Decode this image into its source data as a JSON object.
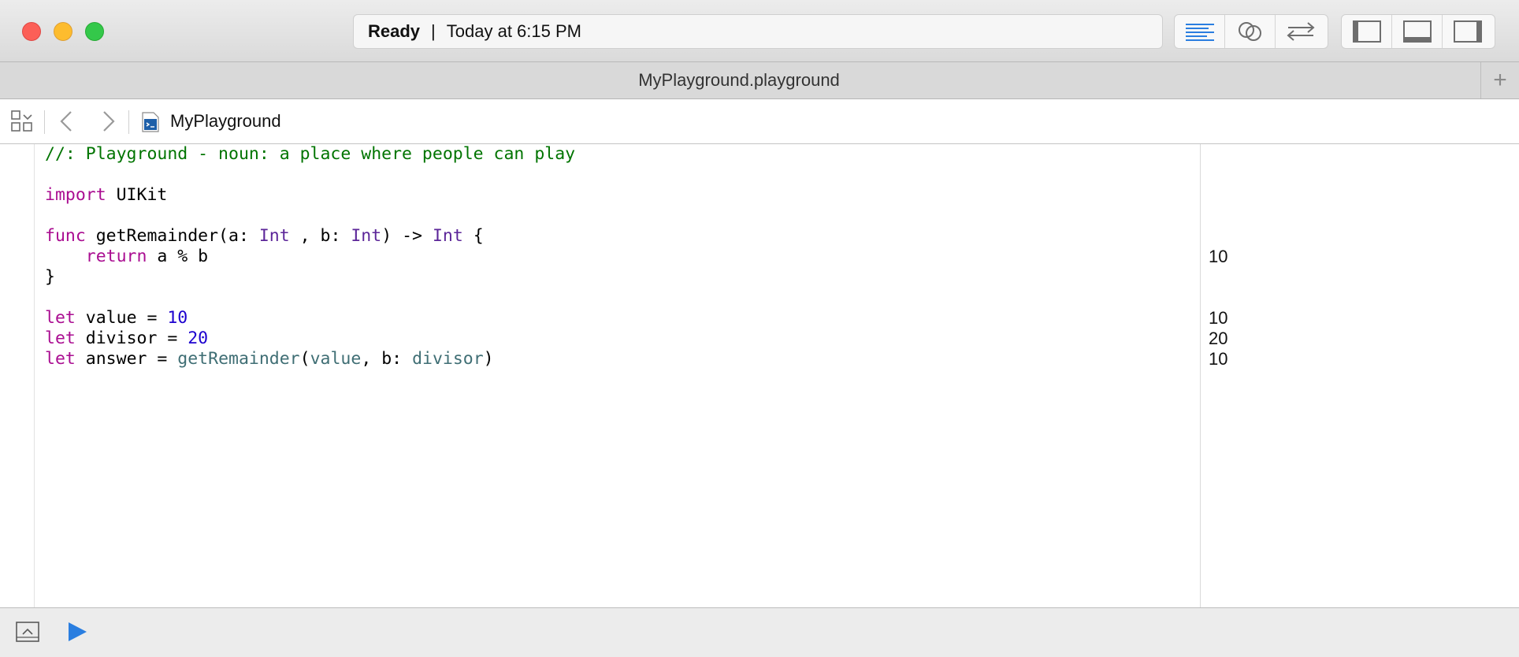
{
  "toolbar": {
    "status": "Ready",
    "separator": "|",
    "timestamp": "Today at 6:15 PM"
  },
  "tab": {
    "title": "MyPlayground.playground",
    "add_label": "+"
  },
  "jumpbar": {
    "file_label": "MyPlayground"
  },
  "editor": {
    "lines": [
      [
        {
          "t": "//: Playground - noun: a place where people can play",
          "c": "comment"
        }
      ],
      [],
      [
        {
          "t": "import",
          "c": "kw"
        },
        {
          "t": " UIKit",
          "c": ""
        }
      ],
      [],
      [
        {
          "t": "func",
          "c": "kw"
        },
        {
          "t": " getRemainder(a: ",
          "c": ""
        },
        {
          "t": "Int",
          "c": "type"
        },
        {
          "t": " , b: ",
          "c": ""
        },
        {
          "t": "Int",
          "c": "type"
        },
        {
          "t": ") -> ",
          "c": ""
        },
        {
          "t": "Int",
          "c": "type"
        },
        {
          "t": " {",
          "c": ""
        }
      ],
      [
        {
          "t": "    ",
          "c": ""
        },
        {
          "t": "return",
          "c": "kw"
        },
        {
          "t": " a % b",
          "c": ""
        }
      ],
      [
        {
          "t": "}",
          "c": ""
        }
      ],
      [],
      [
        {
          "t": "let",
          "c": "kw"
        },
        {
          "t": " value = ",
          "c": ""
        },
        {
          "t": "10",
          "c": "num"
        }
      ],
      [
        {
          "t": "let",
          "c": "kw"
        },
        {
          "t": " divisor = ",
          "c": ""
        },
        {
          "t": "20",
          "c": "num"
        }
      ],
      [
        {
          "t": "let",
          "c": "kw"
        },
        {
          "t": " answer = ",
          "c": ""
        },
        {
          "t": "getRemainder",
          "c": "var"
        },
        {
          "t": "(",
          "c": ""
        },
        {
          "t": "value",
          "c": "var"
        },
        {
          "t": ", b: ",
          "c": ""
        },
        {
          "t": "divisor",
          "c": "var"
        },
        {
          "t": ")",
          "c": ""
        }
      ]
    ],
    "results": [
      "",
      "",
      "",
      "",
      "",
      "10",
      "",
      "",
      "10",
      "20",
      "10"
    ]
  },
  "colors": {
    "comment": "#007400",
    "keyword": "#aa0d91",
    "type": "#5c2699",
    "number": "#1c00cf",
    "identifier": "#3f6e74",
    "accent": "#2a7ee0"
  },
  "icons": {
    "editor_mode": "standard-editor-icon",
    "assistant": "assistant-editor-icon",
    "version": "version-editor-icon",
    "navigator": "navigator-panel-icon",
    "debug": "debug-panel-icon",
    "utilities": "utilities-panel-icon",
    "grid": "related-items-grid-icon",
    "back": "chevron-left-icon",
    "forward": "chevron-right-icon",
    "file": "playground-file-icon",
    "toggle": "debug-area-toggle-icon",
    "run": "play-icon"
  }
}
